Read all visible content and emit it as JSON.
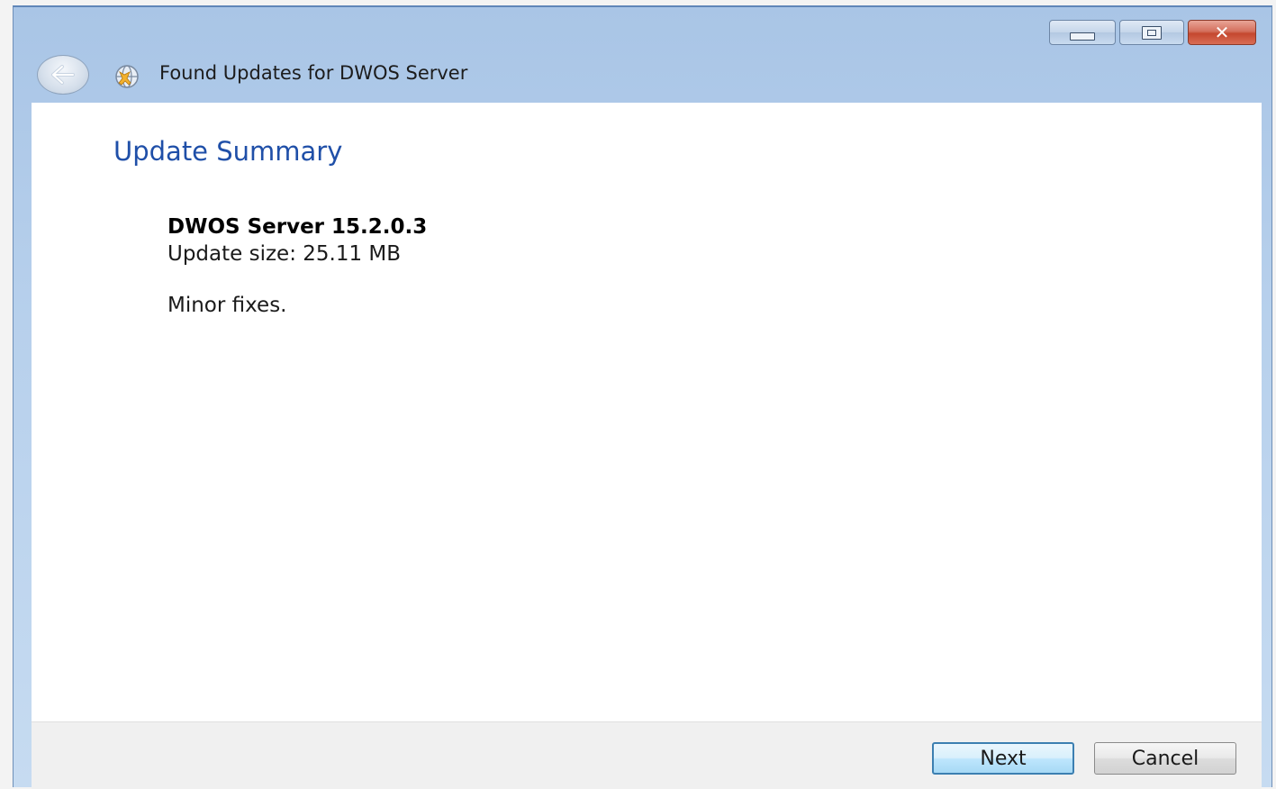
{
  "window": {
    "title": "Found Updates for DWOS Server"
  },
  "caption_buttons": {
    "minimize_icon": "minimize-icon",
    "maximize_icon": "restore-icon",
    "close_glyph": "✕"
  },
  "page": {
    "section_title": "Update Summary",
    "product_name": "DWOS Server 15.2.0.3",
    "update_size": "Update size: 25.11 MB",
    "notes": "Minor fixes."
  },
  "footer": {
    "next_label": "Next",
    "cancel_label": "Cancel"
  },
  "colors": {
    "title_accent": "#1f4fa8",
    "close_button": "#c4472f",
    "default_button_border": "#3c7fb1"
  }
}
